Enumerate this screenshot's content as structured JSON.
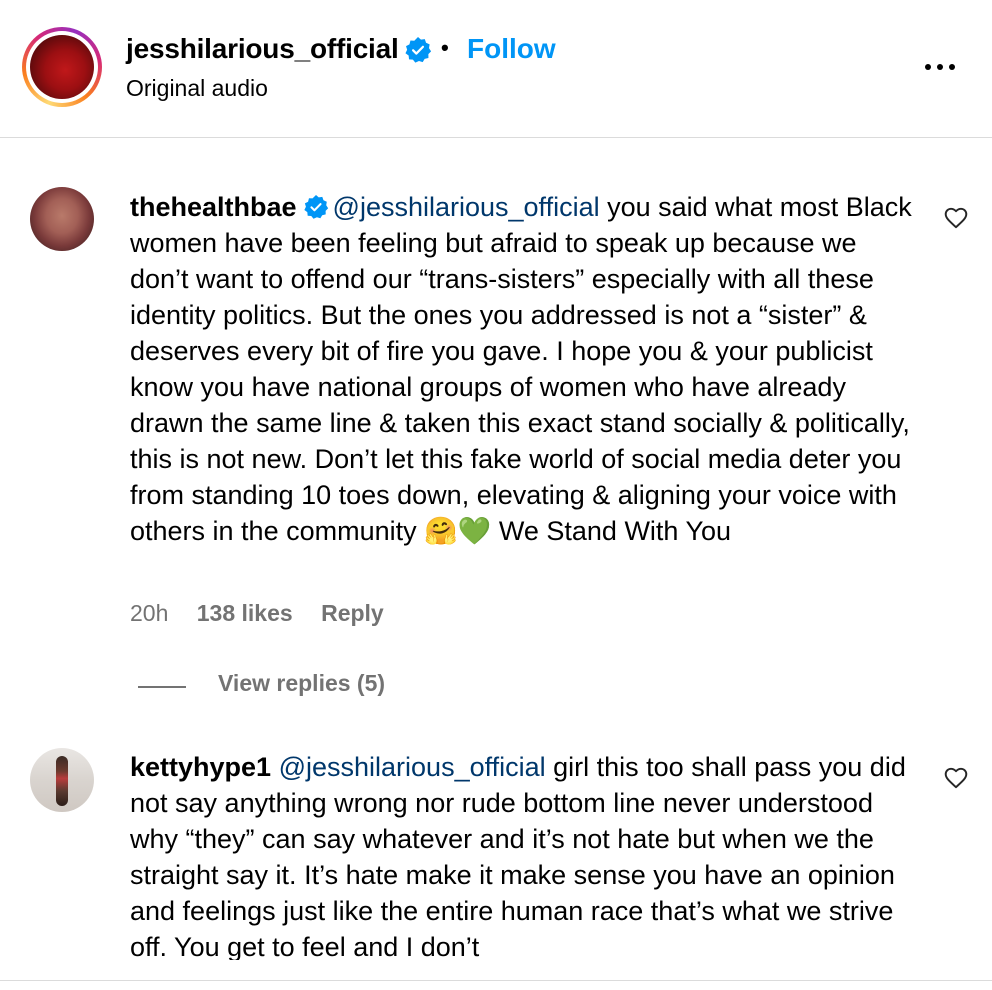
{
  "header": {
    "username": "jesshilarious_official",
    "separator": "•",
    "follow_label": "Follow",
    "subtitle": "Original audio",
    "more_icon": "more-horizontal-icon"
  },
  "comments": [
    {
      "username": "thehealthbae",
      "verified": true,
      "mention": "@jesshilarious_official",
      "text": " you said what most Black women have been feeling but afraid to speak up because we don’t want to offend our “trans-sisters” especially with all these identity politics. But the ones you addressed is not a “sister” & deserves every bit of fire you gave. I hope you & your publicist know you have national groups of women who have already drawn the same line & taken this exact stand socially & politically, this is not new. Don’t let this fake world of social media deter you from standing 10 toes down, elevating & aligning your voice with others in the community 🤗💚 We Stand With You",
      "time": "20h",
      "likes": "138 likes",
      "reply_label": "Reply",
      "view_replies": "View replies (5)"
    },
    {
      "username": "kettyhype1",
      "verified": false,
      "mention": "@jesshilarious_official",
      "text": " girl this too shall pass you did not say anything wrong nor rude bottom line never understood why “they” can say whatever and it’s not hate but when we the straight say it. It’s hate make it make sense you have an opinion and feelings just like the entire human race that’s what we strive off. You get to feel and I don’t"
    }
  ],
  "colors": {
    "accent": "#0095f6",
    "mention": "#00376b",
    "verified": "#0095f6",
    "secondary_text": "#737373",
    "divider": "#dbdbdb"
  }
}
